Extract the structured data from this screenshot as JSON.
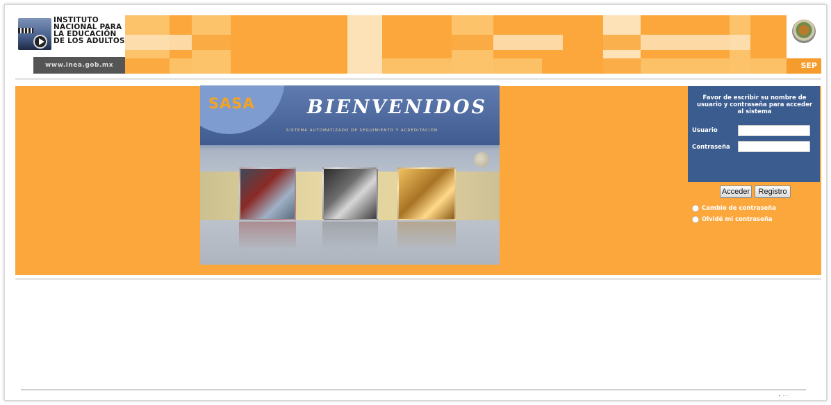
{
  "header": {
    "logo_lines": [
      "INSTITUTO",
      "NACIONAL PARA",
      "LA EDUCACIÓN",
      "DE LOS ADULTOS"
    ],
    "url": "www.inea.gob.mx",
    "sep_label": "SEP"
  },
  "hero": {
    "brand": "SASA",
    "title": "BIENVENIDOS",
    "subtitle": "Sistema Automatizado de Seguimiento y Acreditación"
  },
  "login": {
    "message": "Favor de escribir su nombre de usuario y contraseña para acceder al sistema",
    "username_label": "Usuario",
    "username_value": "",
    "password_label": "Contraseña",
    "password_value": "",
    "submit_label": "Acceder",
    "register_label": "Registro",
    "links": [
      "Cambio de contraseña",
      "Olvidé mi contraseña"
    ]
  },
  "colors": {
    "orange": "#fba73c",
    "panel_blue": "#3b5c8f",
    "brand_orange": "#f5a321"
  }
}
